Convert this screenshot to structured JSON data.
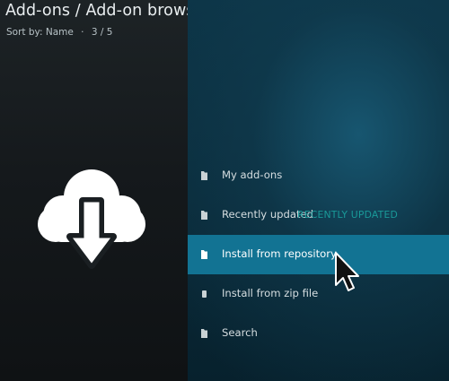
{
  "header": {
    "title": "Add-ons / Add-on browser",
    "sort_by": "Sort by: Name",
    "separator": "·",
    "position": "3 / 5"
  },
  "main_icon": "cloud-download-icon",
  "menu": {
    "items": [
      {
        "label": "My add-ons",
        "icon": "folder-icon"
      },
      {
        "label": "Recently updated",
        "icon": "folder-icon",
        "overlay": "Recently updated"
      },
      {
        "label": "Install from repository",
        "icon": "folder-icon",
        "selected": true
      },
      {
        "label": "Install from zip file",
        "icon": "file-icon"
      },
      {
        "label": "Search",
        "icon": "folder-icon"
      }
    ]
  },
  "colors": {
    "selected_highlight": "#127393",
    "right_background": "#0c3446",
    "left_background": "#1a1f22",
    "overlay_text": "#1aa3a0"
  }
}
